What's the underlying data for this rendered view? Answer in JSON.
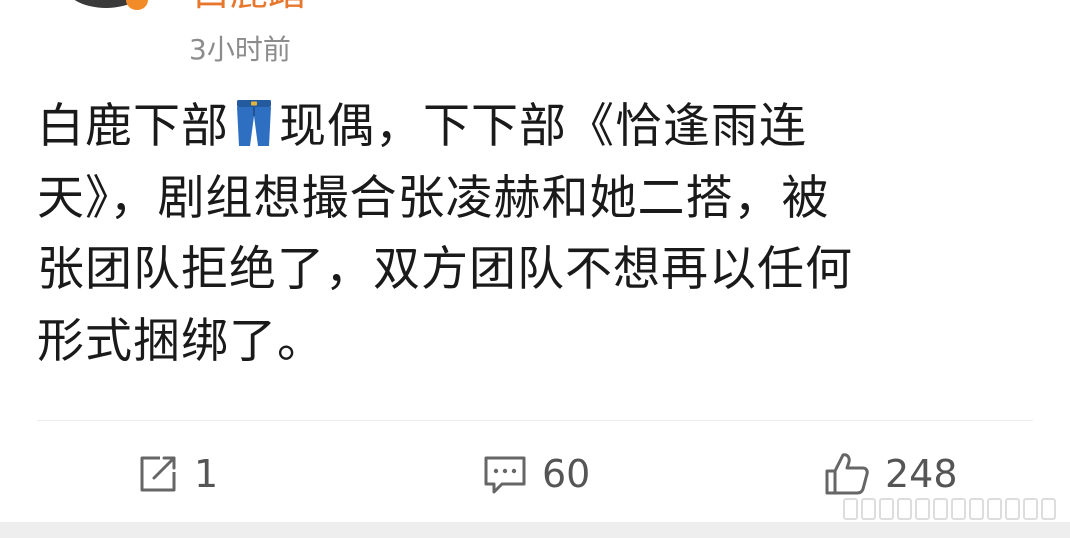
{
  "header": {
    "username": "白鹿踏",
    "timestamp": "3小时前"
  },
  "post": {
    "segments": {
      "line1_before_emoji": "白鹿下部",
      "emoji": "jeans-icon",
      "line1_after_emoji": "现偶，下下部《恰逢雨连",
      "line2": "天》，剧组想撮合张凌赫和她二搭，被",
      "line3": "张团队拒绝了，双方团队不想再以任何",
      "line4": "形式捆绑了。"
    }
  },
  "actions": {
    "repost": {
      "icon": "repost-icon",
      "count": "1"
    },
    "comment": {
      "icon": "comment-icon",
      "count": "60"
    },
    "like": {
      "icon": "thumbs-up-icon",
      "count": "248"
    }
  },
  "colors": {
    "username": "#e8772e",
    "timestamp": "#8c8c8c",
    "text": "#1a1a1a",
    "icon": "#666666",
    "jeans": "#2f6fc1"
  }
}
